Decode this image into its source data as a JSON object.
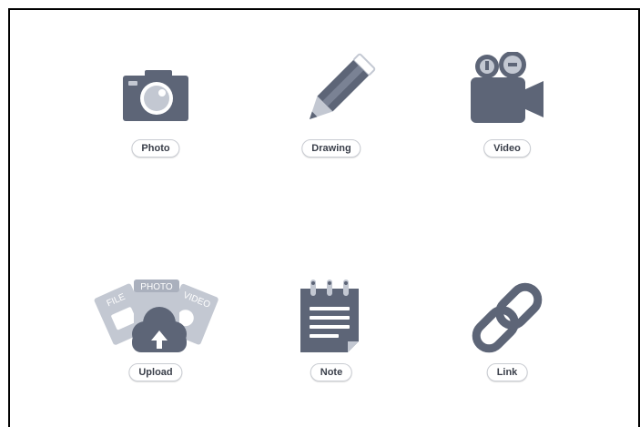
{
  "colors": {
    "icon_primary": "#5d6577",
    "icon_light": "#c3c8d2",
    "icon_mid": "#9aa2b1",
    "frame_border": "#000000",
    "pill_border": "#c9ccd2",
    "pill_text": "#3a3f4a"
  },
  "tiles": [
    {
      "label": "Photo",
      "icon": "camera-icon"
    },
    {
      "label": "Drawing",
      "icon": "pencil-icon"
    },
    {
      "label": "Video",
      "icon": "video-camera-icon"
    },
    {
      "label": "Upload",
      "icon": "upload-cloud-icon",
      "file_tags": [
        "FILE",
        "PHOTO",
        "VIDEO"
      ]
    },
    {
      "label": "Note",
      "icon": "notepad-icon"
    },
    {
      "label": "Link",
      "icon": "link-icon"
    }
  ]
}
